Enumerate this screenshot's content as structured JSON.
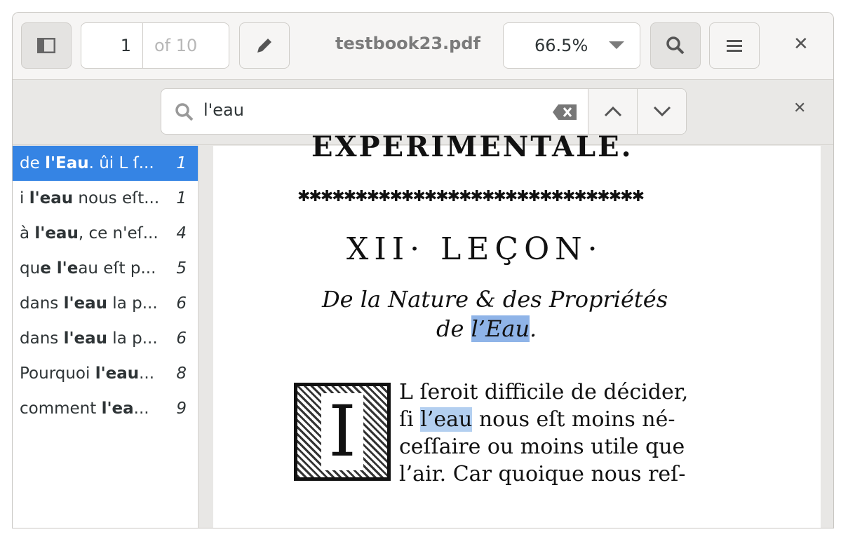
{
  "header": {
    "page_current": "1",
    "page_total": "of 10",
    "title": "testbook23.pdf",
    "zoom": "66.5%"
  },
  "search": {
    "query": "l'eau"
  },
  "results": [
    {
      "pre": "de ",
      "bold": "l'Eau",
      "post": ". ûi L ſ...",
      "page": "1",
      "selected": true
    },
    {
      "pre": "i ",
      "bold": "l'eau",
      "post": " nous eſt...",
      "page": "1"
    },
    {
      "pre": "à ",
      "bold": "l'eau",
      "post": ", ce n'eſ...",
      "page": "4"
    },
    {
      "pre": "qu",
      "bold": "e l'e",
      "post": "au eſt p...",
      "page": "5"
    },
    {
      "pre": "dans ",
      "bold": "l'eau",
      "post": " la p...",
      "page": "6"
    },
    {
      "pre": "dans ",
      "bold": "l'eau",
      "post": " la p...",
      "page": "6"
    },
    {
      "pre": "Pourquoi ",
      "bold": "l'eau",
      "post": "...",
      "page": "8"
    },
    {
      "pre": "comment ",
      "bold": "l'ea",
      "post": "...",
      "page": "9"
    }
  ],
  "document": {
    "running_head": "EXPERIMENTALE.",
    "ornament": "✱✱✱✱✱✱✱✱✱✱✱✱✱✱✱✱✱✱✱✱✱✱✱✱✱✱✱✱✱✱",
    "lesson": "XII· LEÇON·",
    "subtitle1": "De la Nature & des Propriétés",
    "subtitle2_pre": "de ",
    "subtitle2_hl": "l’Eau",
    "subtitle2_post": ".",
    "dropcap": "I",
    "lines": [
      {
        "pre": "L ſeroit difficile de décider,",
        "hl": "",
        "post": ""
      },
      {
        "pre": "ſi ",
        "hl": "l’eau",
        "post": " nous eſt moins né-"
      },
      {
        "pre": "ceſſaire ou moins utile que",
        "hl": "",
        "post": ""
      },
      {
        "pre": "l’air. Car quoique nous reſ-",
        "hl": "",
        "post": ""
      }
    ]
  }
}
